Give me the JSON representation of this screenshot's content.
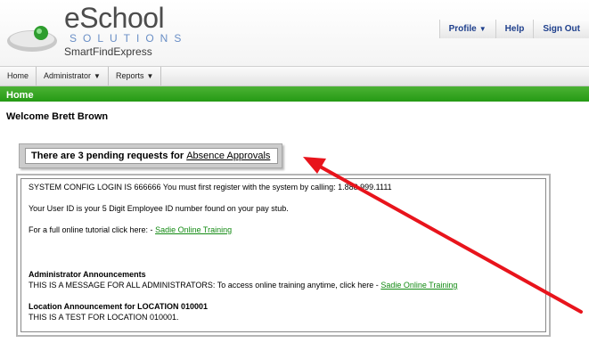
{
  "header": {
    "brand": "eSchool",
    "brand_sub": "SOLUTIONS",
    "brand_product": "SmartFindExpress",
    "top_nav": {
      "profile": "Profile",
      "help": "Help",
      "sign_out": "Sign Out"
    }
  },
  "menu": {
    "home": "Home",
    "administrator": "Administrator",
    "reports": "Reports"
  },
  "breadcrumb": "Home",
  "welcome": "Welcome Brett Brown",
  "pending": {
    "text": "There are 3 pending requests for ",
    "link": "Absence Approvals"
  },
  "messages": {
    "line1": "SYSTEM CONFIG LOGIN IS 666666 You must first register with the system by calling: 1.888.999.1111",
    "line2": "Your User ID is your 5 Digit Employee ID number found on your pay stub.",
    "line3_text": "For a full online tutorial click here: - ",
    "line3_link": "Sadie Online Training",
    "admin_heading": "Administrator Announcements",
    "admin_text": "THIS IS A MESSAGE FOR ALL ADMINISTRATORS: To access online training anytime, click here - ",
    "admin_link": "Sadie Online Training",
    "loc_heading": "Location Announcement for LOCATION 010001",
    "loc_text": "THIS IS A TEST FOR LOCATION 010001."
  },
  "colors": {
    "nav_green": "#259a14",
    "link_green": "#128a12",
    "arrow_red": "#e8141c",
    "nav_blue": "#1e3f8c"
  },
  "icons": [
    "eschool-logo-icon",
    "caret-down-icon",
    "red-arrow-annotation"
  ]
}
